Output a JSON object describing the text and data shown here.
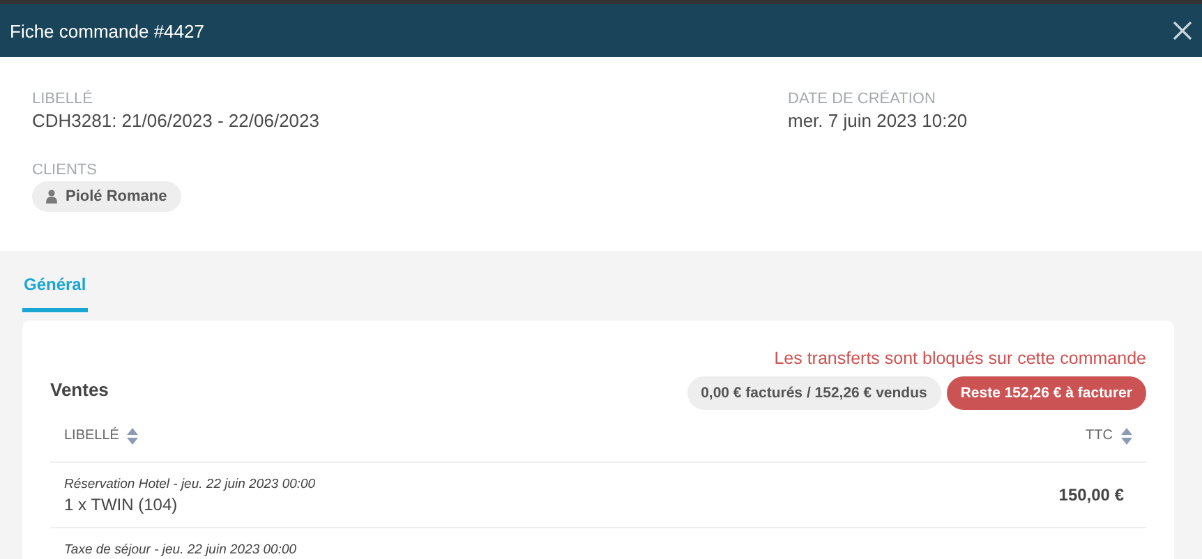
{
  "window": {
    "title": "Fiche commande #4427"
  },
  "fields": [
    {
      "label": "LIBELLÉ",
      "value": "CDH3281: 21/06/2023 - 22/06/2023"
    },
    {
      "label": "DATE DE CRÉATION",
      "value": "mer. 7 juin 2023 10:20"
    }
  ],
  "clients": {
    "label": "CLIENTS",
    "items": [
      "Piolé Romane"
    ]
  },
  "tabs": [
    {
      "label": "Général",
      "selected": true
    }
  ],
  "sales": {
    "title": "Ventes",
    "warning": "Les transferts sont bloqués sur cette commande",
    "badges": [
      {
        "kind": "neutral",
        "text": "0,00 € facturés / 152,26 € vendus"
      },
      {
        "kind": "alert",
        "text": "Reste 152,26 € à facturer"
      }
    ],
    "columns": [
      "LIBELLÉ",
      "TTC"
    ],
    "rows": [
      {
        "caption": "Réservation Hotel - jeu. 22 juin 2023 00:00",
        "label": "1 x TWIN (104)",
        "amount": "150,00 €"
      },
      {
        "caption": "Taxe de séjour - jeu. 22 juin 2023 00:00"
      }
    ]
  }
}
